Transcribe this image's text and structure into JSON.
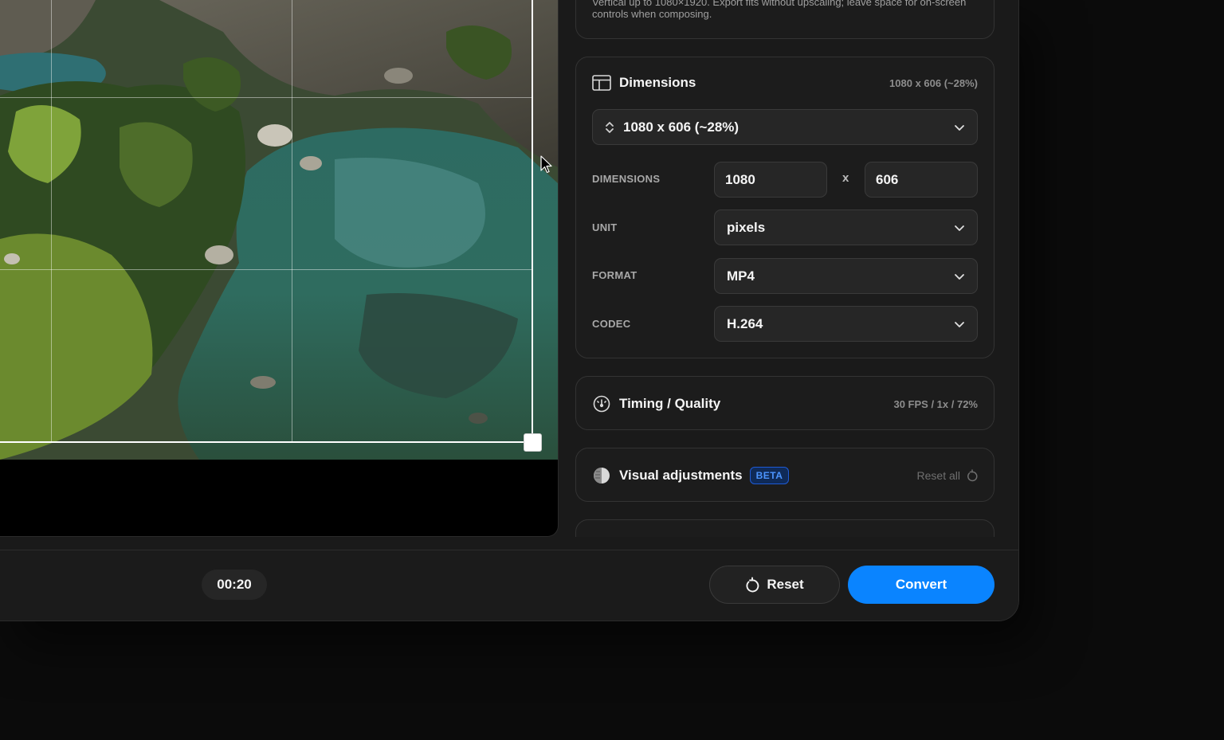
{
  "preset_note": "Vertical up to 1080×1920. Export fits without upscaling; leave space for on-screen controls when composing.",
  "dimensions_card": {
    "title": "Dimensions",
    "summary": "1080 x 606 (~28%)",
    "preset_value": "1080 x 606 (~28%)",
    "dimensions_label": "DIMENSIONS",
    "width": "1080",
    "times": "x",
    "height": "606",
    "unit_label": "UNIT",
    "unit_value": "pixels",
    "format_label": "FORMAT",
    "format_value": "MP4",
    "codec_label": "CODEC",
    "codec_value": "H.264"
  },
  "timing_card": {
    "title": "Timing / Quality",
    "summary": "30 FPS / 1x / 72%"
  },
  "visual_card": {
    "title": "Visual adjustments",
    "badge": "BETA",
    "reset_all": "Reset all"
  },
  "bottom_bar": {
    "time": "00:20",
    "reset_label": "Reset",
    "convert_label": "Convert"
  },
  "colors": {
    "accent": "#0a84ff",
    "badge": "#4c95ff"
  }
}
